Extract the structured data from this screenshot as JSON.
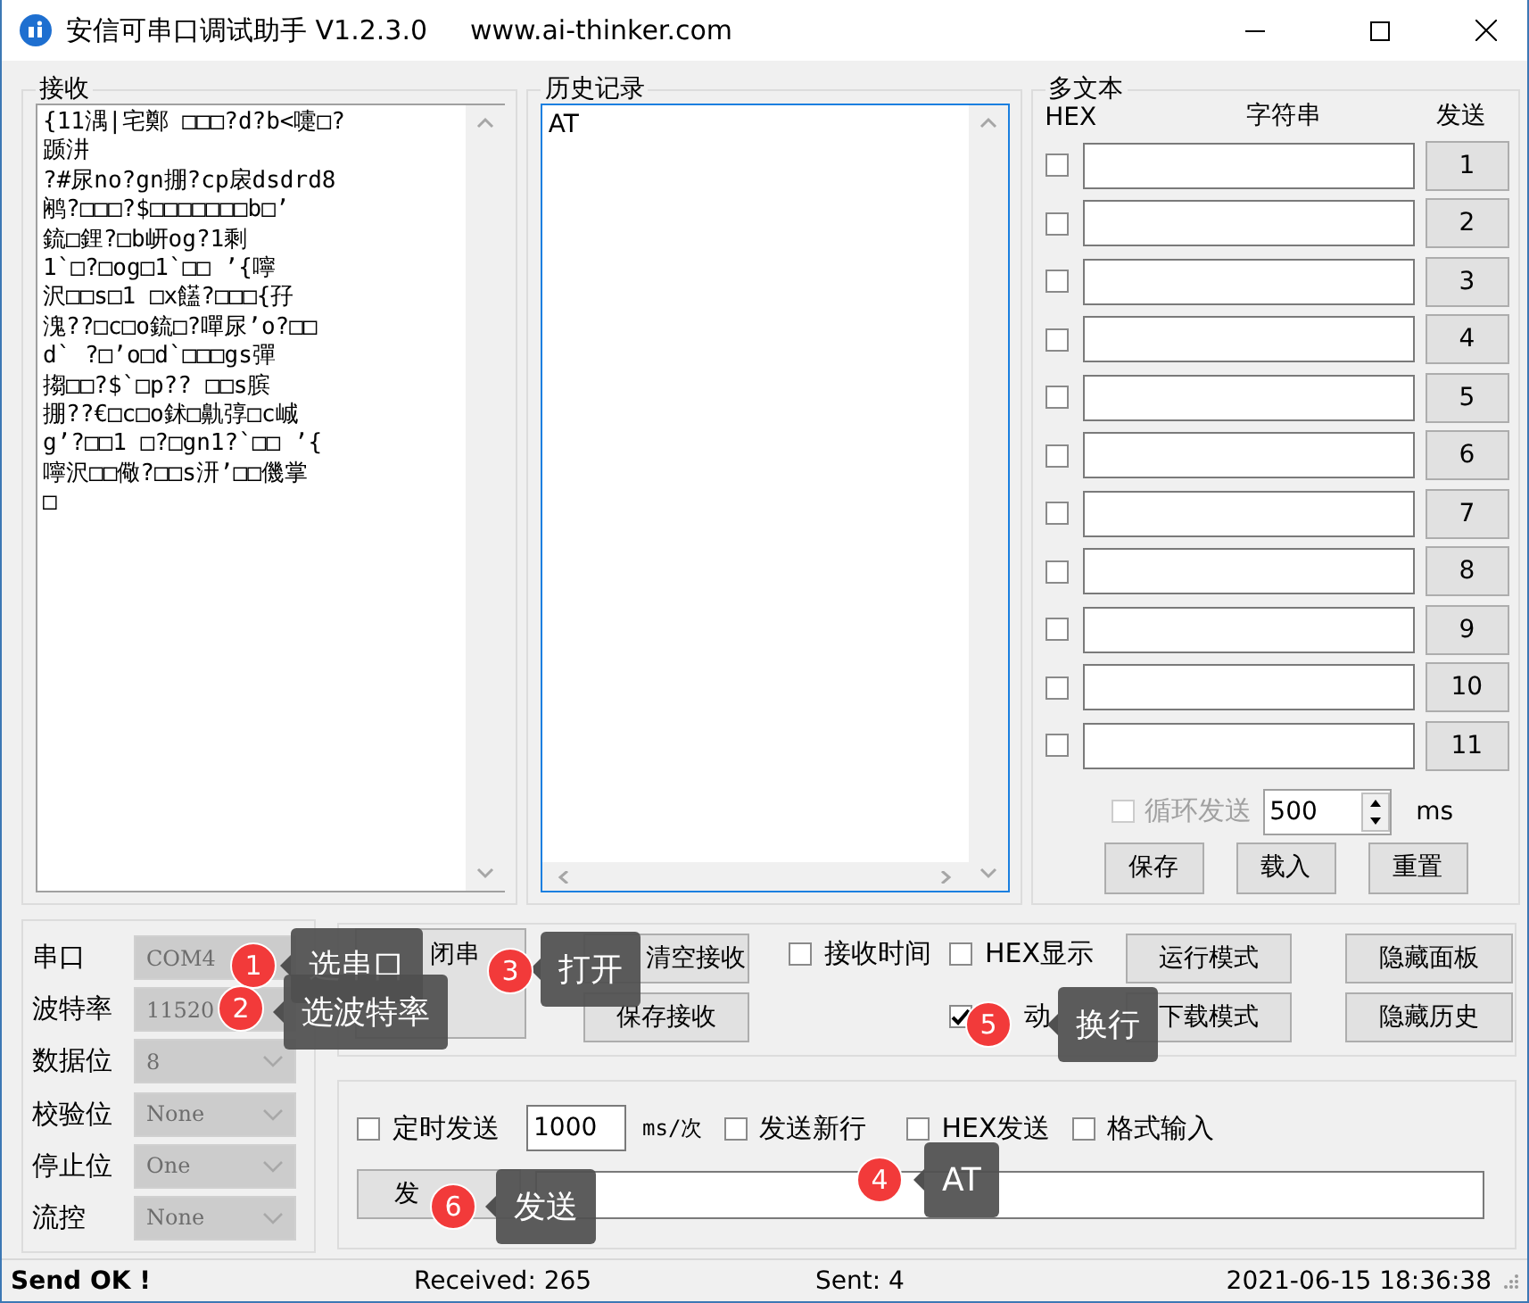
{
  "window": {
    "title": "安信可串口调试助手 V1.2.3.0",
    "url": "www.ai-thinker.com"
  },
  "receive": {
    "title": "接收",
    "lines": [
      "{11湡|宅鄭 □□□?d?b<嚏□?",
      "踬汫",
      "?#尿no?gn掤?cp扆dsdrd8",
      "鹇?□□□?$□□□□□□□b□’",
      "鋶□鋰?□b岍og?1剩",
      "1`□?□og□1`□□ ’{嚀",
      "沢□□s□1 □x饚?□□□{孖",
      "溾??□c□o鋶□?嘽尿’o?□□",
      "d` ?□’o□d`□□□gs彈",
      "搊□□?$`□p?? □□s膑",
      "掤??€□c□o鉥□鼽弴□c峸",
      "g’?□□1 □?□gn1?`□□ ’{",
      "嚀沢□□儆?□□s汧’□□僟掌",
      "□"
    ]
  },
  "history": {
    "title": "历史记录",
    "lines": [
      "AT"
    ]
  },
  "multi_text": {
    "title": "多文本",
    "col_hex": "HEX",
    "col_string": "字符串",
    "col_send": "发送",
    "rows": [
      {
        "hex": false,
        "button": "1"
      },
      {
        "hex": false,
        "button": "2"
      },
      {
        "hex": false,
        "button": "3"
      },
      {
        "hex": false,
        "button": "4"
      },
      {
        "hex": false,
        "button": "5"
      },
      {
        "hex": false,
        "button": "6"
      },
      {
        "hex": false,
        "button": "7"
      },
      {
        "hex": false,
        "button": "8"
      },
      {
        "hex": false,
        "button": "9"
      },
      {
        "hex": false,
        "button": "10"
      },
      {
        "hex": false,
        "button": "11"
      }
    ],
    "loop": {
      "label": "循环发送",
      "checked": false,
      "disabled": true,
      "interval": "500",
      "unit": "ms"
    },
    "buttons": [
      "保存",
      "载入",
      "重置"
    ]
  },
  "serial_settings": [
    {
      "label": "串口",
      "value": "COM4",
      "disabled": true
    },
    {
      "label": "波特率",
      "value": "11520",
      "disabled": true
    },
    {
      "label": "数据位",
      "value": "8",
      "disabled": true
    },
    {
      "label": "校验位",
      "value": "None",
      "disabled": true
    },
    {
      "label": "停止位",
      "value": "One",
      "disabled": true
    },
    {
      "label": "流控",
      "value": "None",
      "disabled": true
    }
  ],
  "controls": {
    "open_button": "闭串",
    "clear_button": "清空接收",
    "save_button": "保存接收",
    "options": [
      {
        "label": "接收时间",
        "checked": false
      },
      {
        "label": "HEX显示",
        "checked": false
      },
      {
        "label": "动",
        "checked": true
      }
    ],
    "mode_buttons": [
      "运行模式",
      "下载模式"
    ],
    "panel_buttons": [
      "隐藏面板",
      "隐藏历史"
    ]
  },
  "send": {
    "timed": {
      "label": "定时发送",
      "checked": false
    },
    "interval": "1000",
    "unit": "ms/次",
    "options": [
      {
        "label": "发送新行",
        "checked": false
      },
      {
        "label": "HEX发送",
        "checked": false
      },
      {
        "label": "格式输入",
        "checked": false
      }
    ],
    "button": "发"
  },
  "status_bar": {
    "message": "Send OK !",
    "received": "Received: 265",
    "sent": "Sent: 4",
    "time": "2021-06-15 18:36:38"
  },
  "callouts": [
    {
      "number": "1",
      "text": "选串口"
    },
    {
      "number": "2",
      "text": "选波特率"
    },
    {
      "number": "3",
      "text": "打开"
    },
    {
      "number": "4",
      "text": "AT"
    },
    {
      "number": "5",
      "text": "换行"
    },
    {
      "number": "6",
      "text": "发送"
    }
  ]
}
